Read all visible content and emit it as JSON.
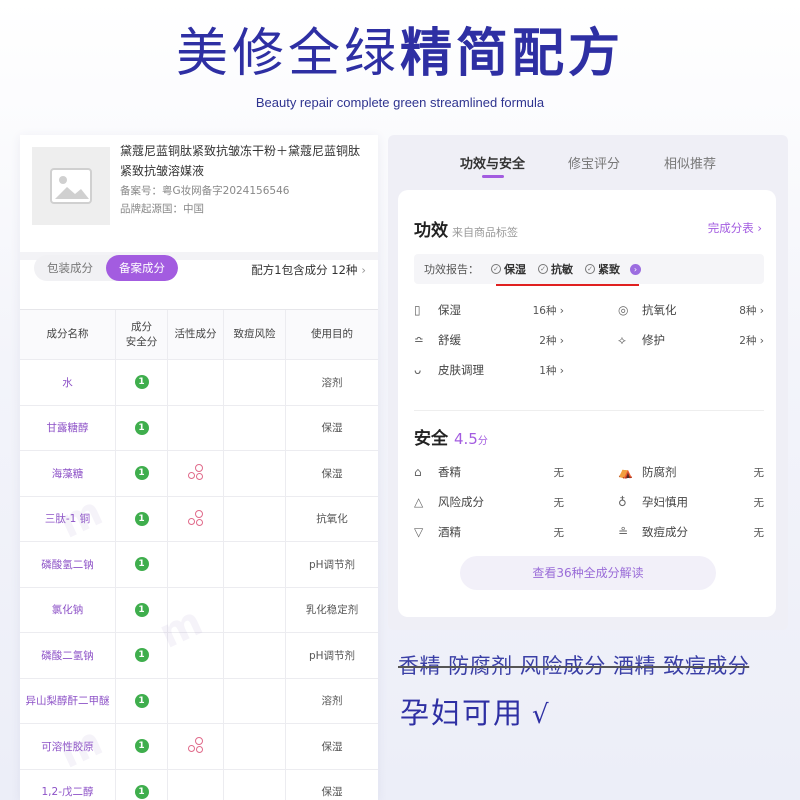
{
  "header": {
    "title_light": "美修全绿",
    "title_bold": "精简配方",
    "subtitle": "Beauty repair complete green streamlined formula"
  },
  "product": {
    "name": "黛蔻尼蓝铜肽紧致抗皱冻干粉＋黛蔻尼蓝铜肽紧致抗皱溶媒液",
    "record_no": "备案号：粤G妆网备字2024156546",
    "origin": "品牌起源国：中国"
  },
  "ingredient_tabs": {
    "packaging": "包装成分",
    "registered": "备案成分",
    "formula_summary": "配方1包含成分 12种"
  },
  "table": {
    "headers": {
      "name": "成分名称",
      "safety_line1": "成分",
      "safety_line2": "安全分",
      "active": "活性成分",
      "acne": "致痘风险",
      "purpose": "使用目的"
    },
    "rows": [
      {
        "name": "水",
        "safety": "1",
        "active": false,
        "purpose": "溶剂"
      },
      {
        "name": "甘露糖醇",
        "safety": "1",
        "active": false,
        "purpose": "保湿"
      },
      {
        "name": "海藻糖",
        "safety": "1",
        "active": true,
        "purpose": "保湿"
      },
      {
        "name": "三肽-1 铜",
        "safety": "1",
        "active": true,
        "purpose": "抗氧化"
      },
      {
        "name": "磷酸氢二钠",
        "safety": "1",
        "active": false,
        "purpose": "pH调节剂"
      },
      {
        "name": "氯化钠",
        "safety": "1",
        "active": false,
        "purpose": "乳化稳定剂"
      },
      {
        "name": "磷酸二氢钠",
        "safety": "1",
        "active": false,
        "purpose": "pH调节剂"
      },
      {
        "name": "异山梨醇酐二甲醚",
        "safety": "1",
        "active": false,
        "purpose": "溶剂"
      },
      {
        "name": "可溶性胶原",
        "safety": "1",
        "active": true,
        "purpose": "保湿"
      },
      {
        "name": "1,2-戊二醇",
        "safety": "1",
        "active": false,
        "purpose": "保湿"
      }
    ]
  },
  "right_tabs": {
    "tab1": "功效与安全",
    "tab2": "修宝评分",
    "tab3": "相似推荐"
  },
  "efficacy": {
    "title": "功效",
    "note": "来自商品标签",
    "all_link": "完成分表",
    "report_label": "功效报告：",
    "tags": [
      "保湿",
      "抗敏",
      "紧致"
    ],
    "items": [
      {
        "label": "保湿",
        "value": "16种"
      },
      {
        "label": "抗氧化",
        "value": "8种"
      },
      {
        "label": "舒缓",
        "value": "2种"
      },
      {
        "label": "修护",
        "value": "2种"
      },
      {
        "label": "皮肤调理",
        "value": "1种"
      }
    ]
  },
  "safety": {
    "title": "安全",
    "score": "4.5",
    "score_unit": "分",
    "items": [
      {
        "label": "香精",
        "value": "无"
      },
      {
        "label": "防腐剂",
        "value": "无"
      },
      {
        "label": "风险成分",
        "value": "无"
      },
      {
        "label": "孕妇慎用",
        "value": "无"
      },
      {
        "label": "酒精",
        "value": "无"
      },
      {
        "label": "致痘成分",
        "value": "无"
      }
    ],
    "cta": "查看36种全成分解读"
  },
  "bottom": {
    "struck": "香精 防腐剂 风险成分 酒精 致痘成分",
    "pregnancy": "孕妇可用",
    "tick": "√"
  },
  "colors": {
    "title_blue": "#2e2fa3",
    "accent_purple": "#a35ce0",
    "safe_green": "#3fae4d",
    "red_underline": "#e02020"
  }
}
